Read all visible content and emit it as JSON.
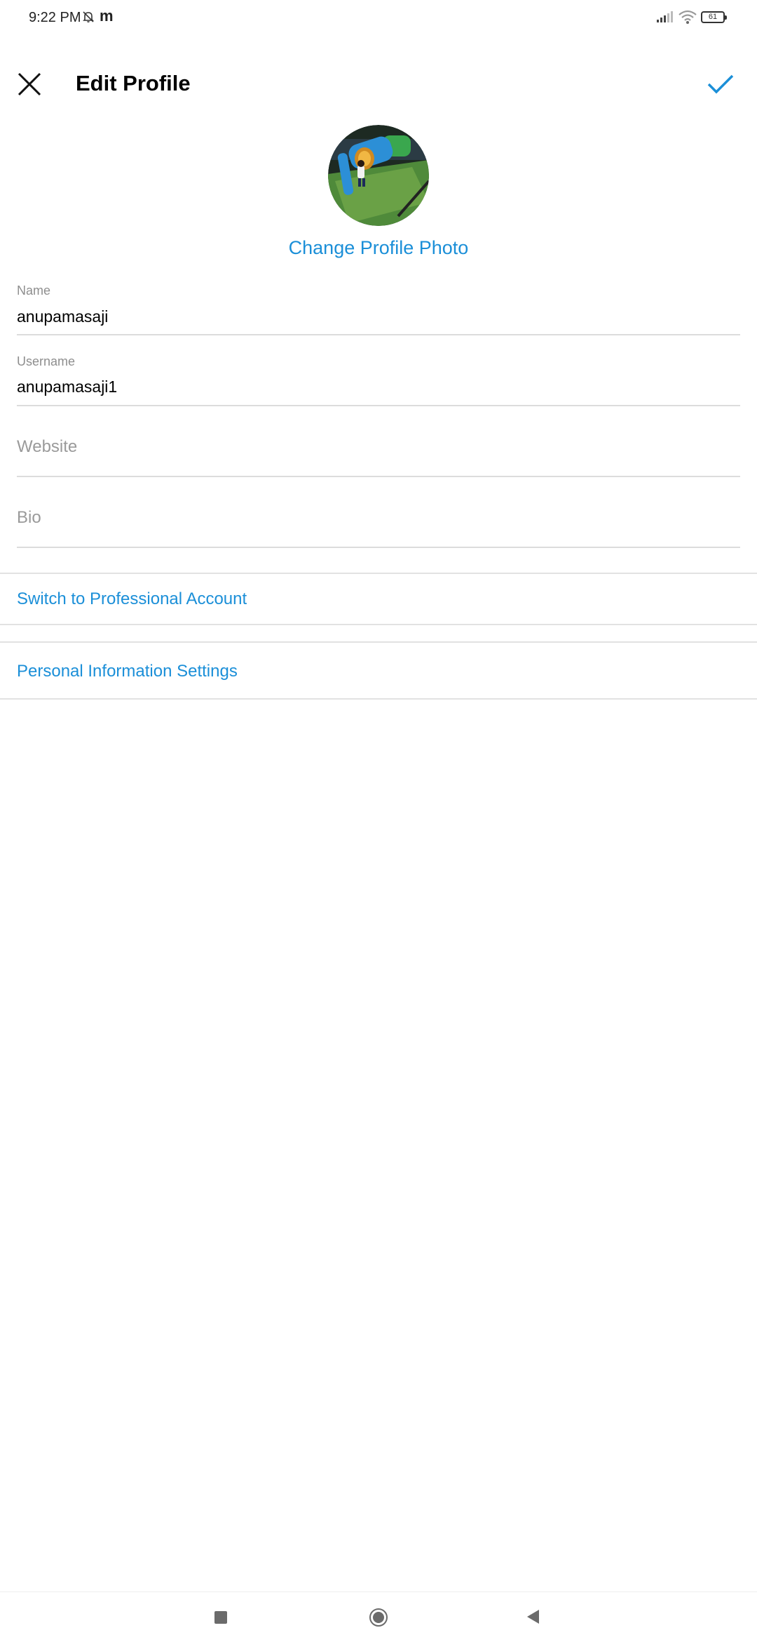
{
  "status_bar": {
    "time": "9:22 PM",
    "app_letter": "m",
    "battery": "61",
    "icons": [
      "mute-bell-icon",
      "signal-icon",
      "wifi-icon",
      "battery-icon"
    ]
  },
  "header": {
    "title": "Edit Profile",
    "close_icon": "close-icon",
    "done_icon": "checkmark-icon",
    "accent_color": "#1b8fd8"
  },
  "profile": {
    "change_photo_label": "Change Profile Photo"
  },
  "fields": {
    "name": {
      "label": "Name",
      "value": "anupamasaji"
    },
    "username": {
      "label": "Username",
      "value": "anupamasaji1"
    },
    "website": {
      "placeholder": "Website"
    },
    "bio": {
      "placeholder": "Bio"
    }
  },
  "links": {
    "professional": "Switch to Professional Account",
    "personal_info": "Personal Information Settings"
  },
  "nav": {
    "icons": [
      "recents-icon",
      "home-icon",
      "back-icon"
    ]
  }
}
